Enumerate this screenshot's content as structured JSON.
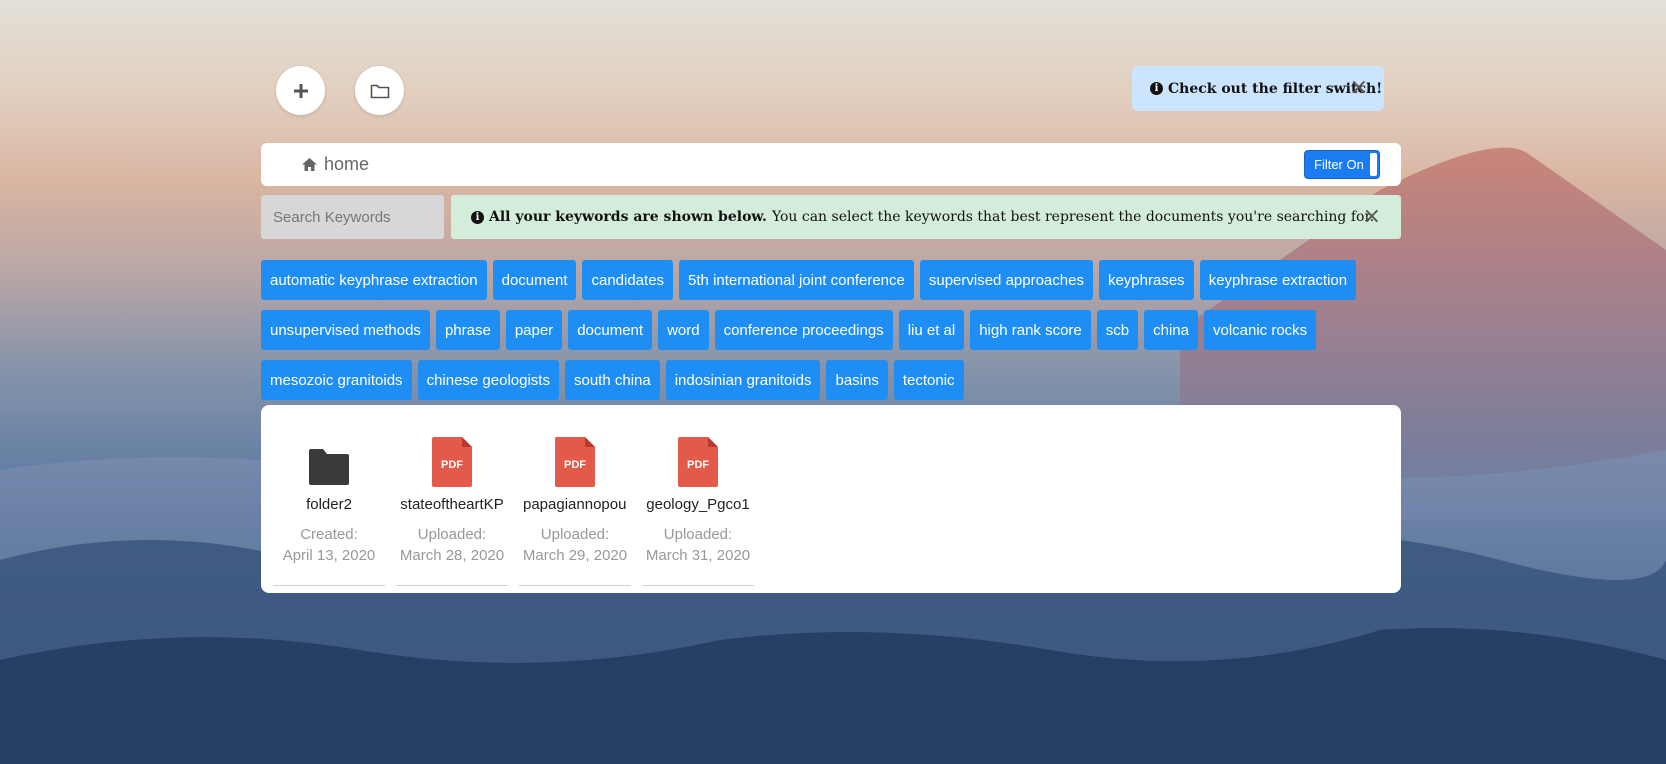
{
  "toolbar": {
    "add_button_icon": "plus-icon",
    "folder_button_icon": "folder-outline-icon"
  },
  "toast": {
    "text": "Check out the filter switch!",
    "close": "×"
  },
  "breadcrumb": {
    "icon": "home-icon",
    "label": "home"
  },
  "filter_switch": {
    "label": "Filter On",
    "state": "on"
  },
  "search": {
    "placeholder": "Search Keywords",
    "value": ""
  },
  "alert": {
    "bold_text": "All your keywords are shown below.",
    "text": "You can select the keywords that best represent the documents you're searching for.",
    "close": "×"
  },
  "keywords": [
    [
      "automatic keyphrase extraction",
      "document",
      "candidates",
      "5th international joint conference",
      "supervised approaches",
      "keyphrases",
      "keyphrase extraction"
    ],
    [
      "unsupervised methods",
      "phrase",
      "paper",
      "document",
      "word",
      "conference proceedings",
      "liu et al",
      "high rank score",
      "scb",
      "china",
      "volcanic rocks"
    ],
    [
      "mesozoic granitoids",
      "chinese geologists",
      "south china",
      "indosinian granitoids",
      "basins",
      "tectonic"
    ]
  ],
  "files": [
    {
      "name": "folder2",
      "type": "folder",
      "label": "Created:",
      "date": "April 13, 2020"
    },
    {
      "name": "stateoftheartKP",
      "type": "pdf",
      "label": "Uploaded:",
      "date": "March 28, 2020"
    },
    {
      "name": "papagiannopoulou",
      "type": "pdf",
      "label": "Uploaded:",
      "date": "March 29, 2020"
    },
    {
      "name": "geology_Pgco1",
      "type": "pdf",
      "label": "Uploaded:",
      "date": "March 31, 2020"
    }
  ],
  "colors": {
    "keyword_bg": "#1e8ef5",
    "pdf_red": "#e35a4a",
    "folder_dark": "#3a3a3a",
    "toast_bg": "#cce5ff",
    "alert_bg": "#d4edda",
    "switch_bg": "#1a7cf0"
  }
}
